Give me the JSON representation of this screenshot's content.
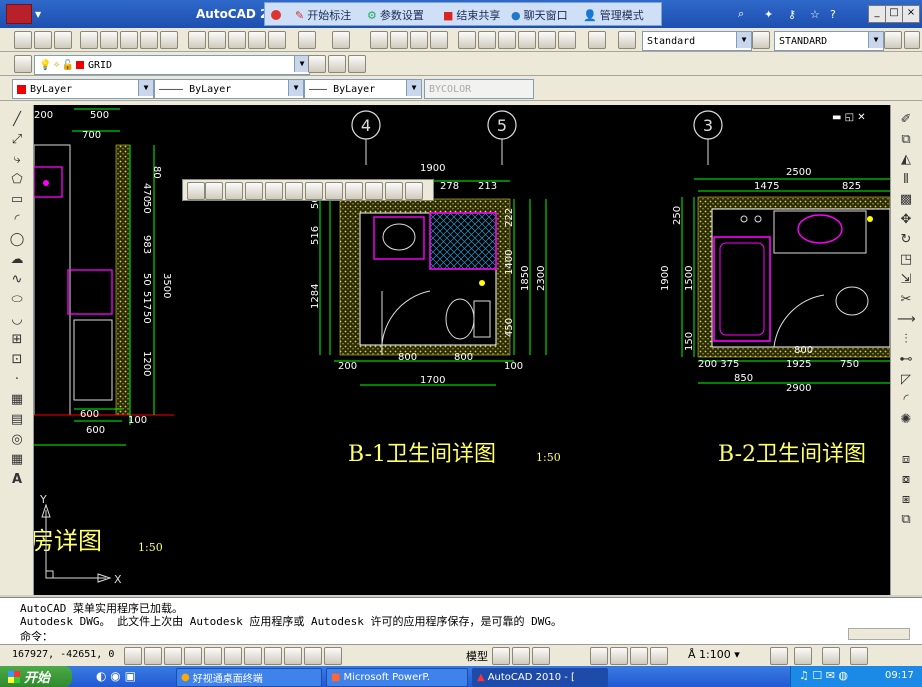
{
  "window": {
    "app_title": "AutoCAD  2",
    "share_bar": {
      "items": [
        "开始标注",
        "参数设置",
        "结束共享",
        "聊天窗口",
        "管理模式"
      ]
    },
    "controls": [
      "_",
      "□",
      "×"
    ]
  },
  "toolbars": {
    "text_style": "Standard",
    "dim_style": "STANDARD",
    "layer": "GRID",
    "color": "ByLayer",
    "linetype": "———— ByLayer",
    "lineweight": "——— ByLayer",
    "plotstyle": "BYCOLOR"
  },
  "drawing": {
    "grid_bubbles": [
      "4",
      "5",
      "3"
    ],
    "dims_b1": {
      "top_total": "1900",
      "top_a": "278",
      "top_b": "213",
      "left_a": "50",
      "left_b": "516",
      "left_c": "1284",
      "right_a": "222",
      "right_b": "1400",
      "right_c": "1850",
      "right_d": "2300",
      "right_e": "450",
      "bottom_a": "800",
      "bottom_b": "800",
      "bottom_total": "1700",
      "bottom_l": "200",
      "bottom_r": "100"
    },
    "dims_b2": {
      "top_total": "2500",
      "top_a": "1475",
      "top_b": "825",
      "left_a": "250",
      "left_b": "1900",
      "left_c": "1500",
      "left_d": "150",
      "bottom_a": "800",
      "bottom_b": "200 375",
      "bottom_c": "1925",
      "bottom_d": "750",
      "bottom_e": "850",
      "bottom_total": "2900"
    },
    "dims_left": {
      "top_a": "200",
      "top_b": "500",
      "top_c": "700",
      "v_a": "80",
      "v_b": "470",
      "v_c": "50",
      "v_d": "983",
      "v_e": "50",
      "v_f": "517",
      "v_g": "50",
      "v_h": "1200",
      "v_total": "3500",
      "bot_a": "600",
      "bot_b": "100",
      "bot_c": "600"
    },
    "title_b1": "B-1卫生间详图",
    "scale_b1": "1:50",
    "title_b2": "B-2卫生间详图",
    "title_left": "房详图",
    "scale_left": "1:50",
    "ucs_x": "X",
    "ucs_y": "Y"
  },
  "command": {
    "line1": "AutoCAD 菜单实用程序已加载。",
    "line2": "Autodesk DWG。  此文件上次由 Autodesk 应用程序或 Autodesk 许可的应用程序保存，是可靠的 DWG。",
    "prompt": "命令："
  },
  "status": {
    "coords": "167927, -42651, 0",
    "model": "模型",
    "scale": "1:100"
  },
  "taskbar": {
    "start": "开始",
    "tasks": [
      "好视通桌面终端",
      "Microsoft PowerP.",
      "AutoCAD 2010 - ["
    ],
    "clock": "09:17"
  },
  "colors": {
    "title_blue": "#2159c4",
    "canvas": "#000000",
    "dim_green": "#00ff00",
    "title_yellow": "#ffff66",
    "wall_magenta": "#ff00ff",
    "hatch_yellow": "#d6cf3a"
  }
}
